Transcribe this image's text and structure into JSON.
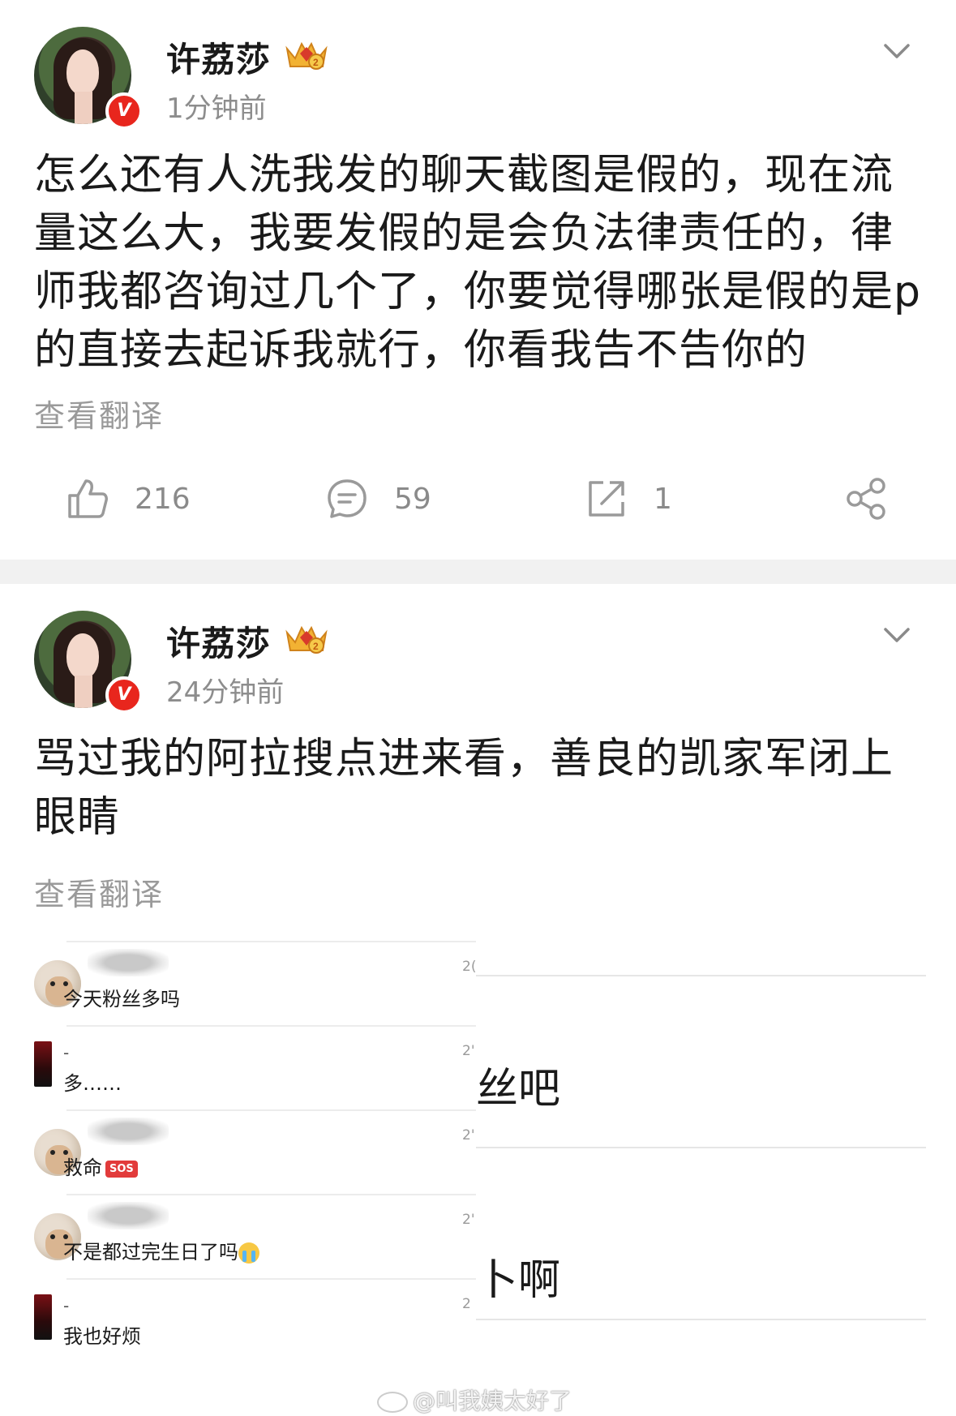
{
  "posts": [
    {
      "username": "许荔莎",
      "timestamp": "1分钟前",
      "content": "怎么还有人洗我发的聊天截图是假的，现在流量这么大，我要发假的是会负法律责任的，律师我都咨询过几个了，你要觉得哪张是假的是p的直接去起诉我就行，你看我告不告你的",
      "translate_label": "查看翻译",
      "likes": "216",
      "comments": "59",
      "reposts": "1"
    },
    {
      "username": "许荔莎",
      "timestamp": "24分钟前",
      "content": "骂过我的阿拉搜点进来看，善良的凯家军闭上眼睛",
      "translate_label": "查看翻译"
    }
  ],
  "embedded_chat": {
    "rows": [
      {
        "name_dash": "",
        "message": "今天粉丝多吗",
        "time": "2(",
        "avatar": "sheep"
      },
      {
        "name_dash": "-",
        "message": "多……",
        "time": "2'",
        "avatar": "red-thumbnail"
      },
      {
        "name_dash": "",
        "message": "救命",
        "badge": "SOS",
        "time": "2'",
        "avatar": "sheep"
      },
      {
        "name_dash": "",
        "message": "不是都过完生日了吗",
        "emoji": "crying-face",
        "time": "2'",
        "avatar": "sheep"
      },
      {
        "name_dash": "-",
        "message": "我也好烦",
        "time": "2",
        "avatar": "red-thumbnail"
      }
    ],
    "right_fragments": [
      "丝吧",
      "卜啊"
    ]
  },
  "watermark": "@叫我姨太好了",
  "colors": {
    "verified_badge": "#e8261d",
    "divider": "#f1f1f1",
    "muted_text": "#8d8d8d"
  }
}
